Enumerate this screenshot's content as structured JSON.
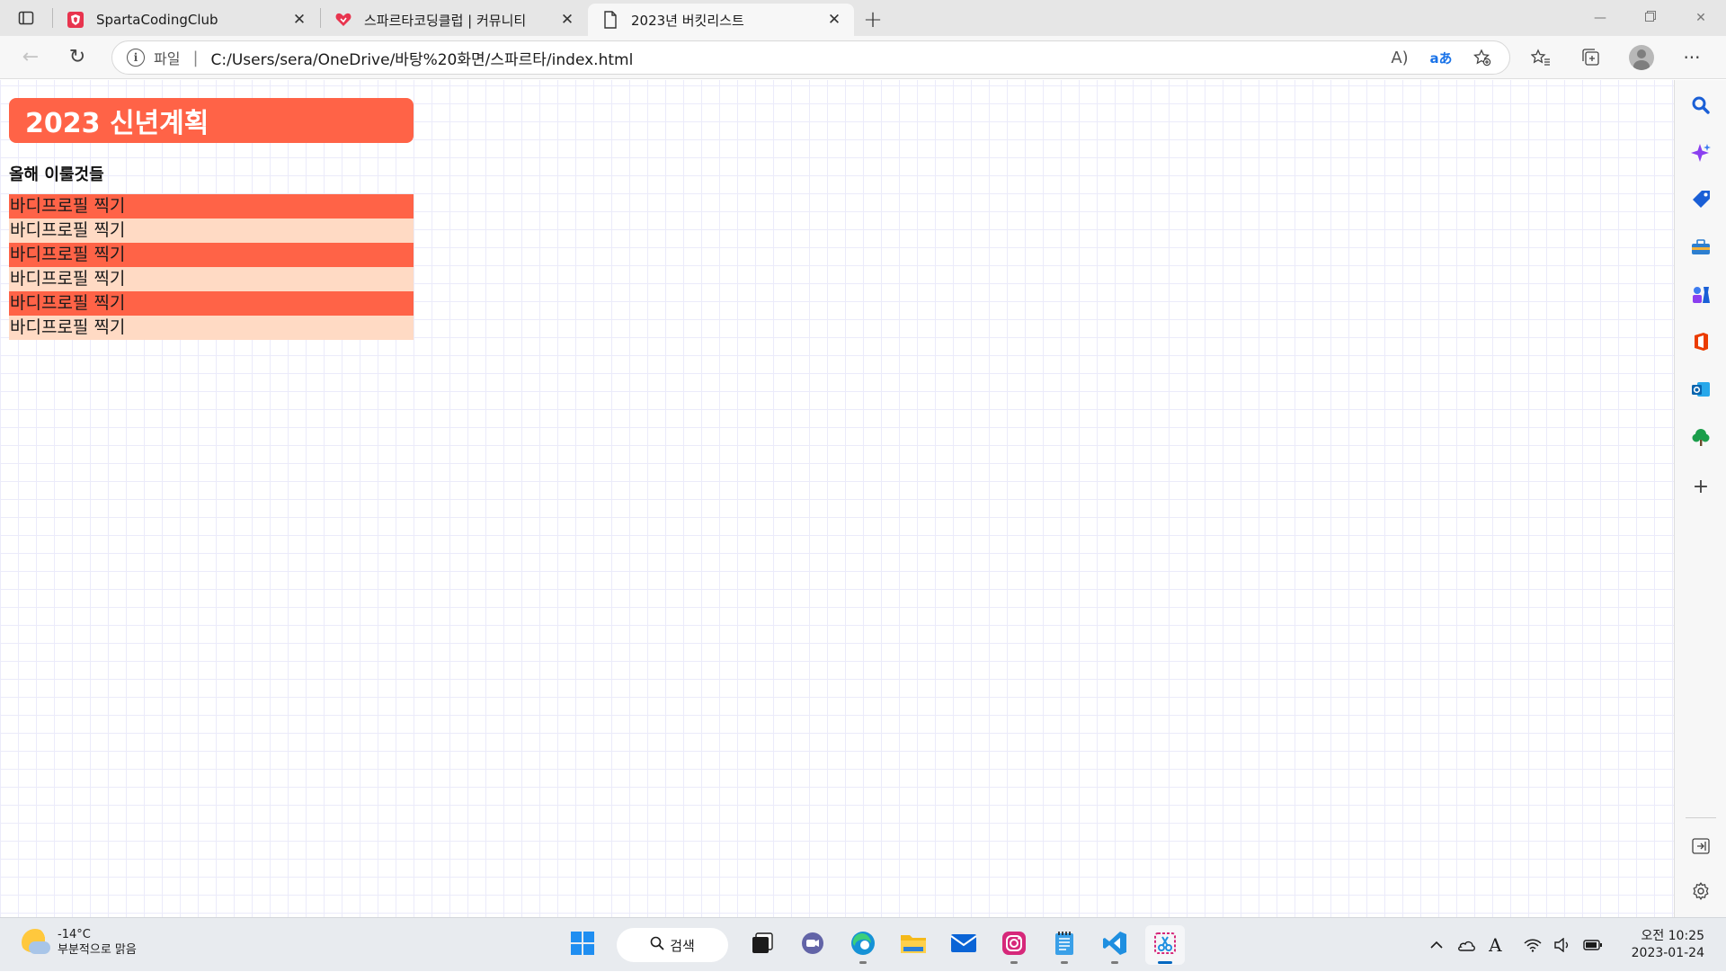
{
  "browser": {
    "tabs": [
      {
        "title": "SpartaCodingClub",
        "favicon": "sparta-shield-icon",
        "active": false
      },
      {
        "title": "스파르타코딩클럽 | 커뮤니티",
        "favicon": "heart-icon",
        "active": false
      },
      {
        "title": "2023년 버킷리스트",
        "favicon": "page-icon",
        "active": true
      }
    ],
    "address": {
      "scheme_label": "파일",
      "divider": "|",
      "url": "C:/Users/sera/OneDrive/바탕%20화면/스파르타/index.html"
    },
    "icons": {
      "read_aloud": "A)",
      "translate": "aあ"
    }
  },
  "page": {
    "title": "2023 신년계획",
    "subtitle": "올해 이룰것들",
    "items": [
      "바디프로필 찍기",
      "바디프로필 찍기",
      "바디프로필 찍기",
      "바디프로필 찍기",
      "바디프로필 찍기",
      "바디프로필 찍기"
    ],
    "colors": {
      "accent": "#ff6347",
      "item_light": "#ffdac4",
      "grid_line": "#ebebfa"
    }
  },
  "taskbar": {
    "weather_temp": "-14°C",
    "weather_desc": "부분적으로 맑음",
    "search_label": "검색",
    "time": "오전 10:25",
    "date": "2023-01-24"
  }
}
